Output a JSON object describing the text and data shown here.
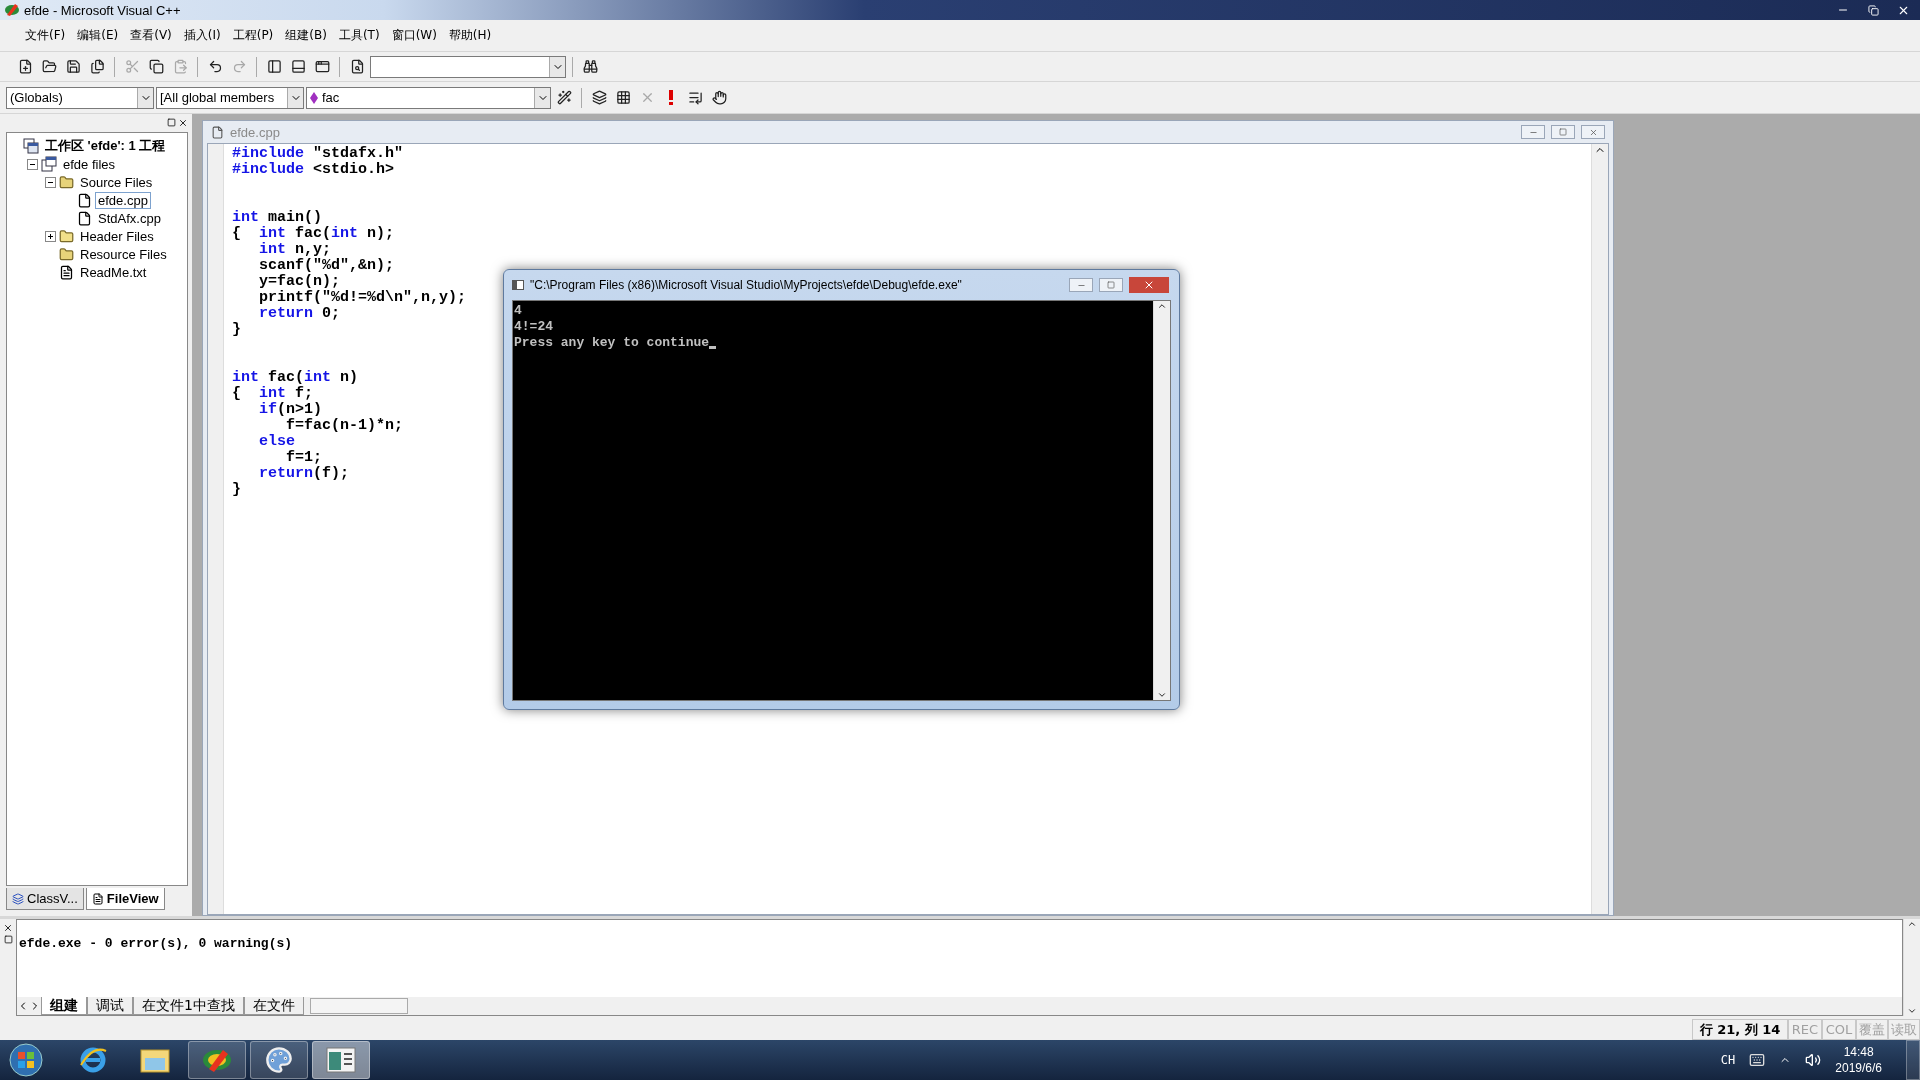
{
  "window": {
    "title": "efde - Microsoft Visual C++"
  },
  "menu": [
    "文件(F)",
    "编辑(E)",
    "查看(V)",
    "插入(I)",
    "工程(P)",
    "组建(B)",
    "工具(T)",
    "窗口(W)",
    "帮助(H)"
  ],
  "toolbar": [
    {
      "kind": "new",
      "disabled": false
    },
    {
      "kind": "open",
      "disabled": false
    },
    {
      "kind": "save",
      "disabled": false
    },
    {
      "kind": "save-all",
      "disabled": false
    },
    {
      "kind": "separator"
    },
    {
      "kind": "cut",
      "disabled": true
    },
    {
      "kind": "copy",
      "disabled": false
    },
    {
      "kind": "paste",
      "disabled": true
    },
    {
      "kind": "separator"
    },
    {
      "kind": "undo",
      "disabled": false
    },
    {
      "kind": "redo",
      "disabled": true
    },
    {
      "kind": "separator"
    },
    {
      "kind": "workspace",
      "disabled": false
    },
    {
      "kind": "output",
      "disabled": false
    },
    {
      "kind": "windows",
      "disabled": false
    },
    {
      "kind": "separator"
    },
    {
      "kind": "find-in-files",
      "disabled": false
    },
    {
      "kind": "find-combo"
    },
    {
      "kind": "separator"
    },
    {
      "kind": "find",
      "disabled": false
    }
  ],
  "wizard_bar": {
    "class_combo": "(Globals)",
    "members_combo": "[All global members",
    "function_combo": "fac"
  },
  "build_toolbar": [
    {
      "kind": "compile",
      "disabled": false
    },
    {
      "kind": "build",
      "disabled": false
    },
    {
      "kind": "stop",
      "disabled": true
    },
    {
      "kind": "execute",
      "disabled": false
    },
    {
      "kind": "step",
      "disabled": false
    },
    {
      "kind": "breakpoint",
      "disabled": false
    }
  ],
  "workspace": {
    "tree": [
      {
        "label": "工作区 'efde': 1 工程",
        "kind": "workspace",
        "children": [
          {
            "label": "efde files",
            "kind": "project",
            "expanded": true,
            "children": [
              {
                "label": "Source Files",
                "kind": "folder",
                "expanded": true,
                "children": [
                  {
                    "label": "efde.cpp",
                    "kind": "cpp",
                    "selected": true
                  },
                  {
                    "label": "StdAfx.cpp",
                    "kind": "cpp",
                    "selected": false
                  }
                ]
              },
              {
                "label": "Header Files",
                "kind": "folder",
                "expanded": false
              },
              {
                "label": "Resource Files",
                "kind": "folder"
              },
              {
                "label": "ReadMe.txt",
                "kind": "text"
              }
            ]
          }
        ]
      }
    ],
    "tabs": [
      {
        "label": "ClassV...",
        "kind": "class",
        "selected": false
      },
      {
        "label": "FileView",
        "kind": "file",
        "selected": true
      }
    ]
  },
  "editor": {
    "title": "efde.cpp",
    "lines": [
      {
        "kind": "code",
        "tokens": [
          {
            "kind": "keyword",
            "text": "#include"
          },
          {
            "kind": "plain",
            "text": " \"stdafx.h\""
          }
        ]
      },
      {
        "kind": "code",
        "tokens": [
          {
            "kind": "keyword",
            "text": "#include"
          },
          {
            "kind": "plain",
            "text": " <stdio.h>"
          }
        ]
      },
      {
        "kind": "blank"
      },
      {
        "kind": "blank"
      },
      {
        "kind": "code",
        "tokens": [
          {
            "kind": "keyword",
            "text": "int"
          },
          {
            "kind": "plain",
            "text": " main()"
          }
        ]
      },
      {
        "kind": "code",
        "tokens": [
          {
            "kind": "plain",
            "text": "{  "
          },
          {
            "kind": "keyword",
            "text": "int"
          },
          {
            "kind": "plain",
            "text": " fac("
          },
          {
            "kind": "keyword",
            "text": "int"
          },
          {
            "kind": "plain",
            "text": " n);"
          }
        ]
      },
      {
        "kind": "code",
        "tokens": [
          {
            "kind": "keyword",
            "text": "   int"
          },
          {
            "kind": "plain",
            "text": " n,y;"
          }
        ]
      },
      {
        "kind": "code",
        "tokens": [
          {
            "kind": "plain",
            "text": "   scanf(\"%d\",&n);"
          }
        ]
      },
      {
        "kind": "code",
        "tokens": [
          {
            "kind": "plain",
            "text": "   y=fac(n);"
          }
        ]
      },
      {
        "kind": "code",
        "tokens": [
          {
            "kind": "plain",
            "text": "   printf(\"%d!=%d\\n\",n,y);"
          }
        ]
      },
      {
        "kind": "code",
        "tokens": [
          {
            "kind": "keyword",
            "text": "   return"
          },
          {
            "kind": "plain",
            "text": " 0;"
          }
        ]
      },
      {
        "kind": "code",
        "tokens": [
          {
            "kind": "plain",
            "text": "}"
          }
        ]
      },
      {
        "kind": "blank"
      },
      {
        "kind": "blank"
      },
      {
        "kind": "code",
        "tokens": [
          {
            "kind": "keyword",
            "text": "int"
          },
          {
            "kind": "plain",
            "text": " fac("
          },
          {
            "kind": "keyword",
            "text": "int"
          },
          {
            "kind": "plain",
            "text": " n)"
          }
        ]
      },
      {
        "kind": "code",
        "tokens": [
          {
            "kind": "plain",
            "text": "{  "
          },
          {
            "kind": "keyword",
            "text": "int"
          },
          {
            "kind": "plain",
            "text": " f;"
          }
        ]
      },
      {
        "kind": "code",
        "tokens": [
          {
            "kind": "keyword",
            "text": "   if"
          },
          {
            "kind": "plain",
            "text": "(n>1)"
          }
        ]
      },
      {
        "kind": "code",
        "tokens": [
          {
            "kind": "plain",
            "text": "      f=fac(n-1)*n;"
          }
        ]
      },
      {
        "kind": "code",
        "tokens": [
          {
            "kind": "keyword",
            "text": "   else"
          }
        ]
      },
      {
        "kind": "code",
        "tokens": [
          {
            "kind": "plain",
            "text": "      f=1;"
          }
        ]
      },
      {
        "kind": "code",
        "tokens": [
          {
            "kind": "keyword",
            "text": "   return"
          },
          {
            "kind": "plain",
            "text": "(f);"
          }
        ]
      },
      {
        "kind": "code",
        "tokens": [
          {
            "kind": "plain",
            "text": "}"
          }
        ]
      }
    ]
  },
  "console": {
    "title": "\"C:\\Program Files (x86)\\Microsoft Visual Studio\\MyProjects\\efde\\Debug\\efde.exe\"",
    "lines": [
      "4",
      "4!=24",
      "Press any key to continue"
    ],
    "cursor": true
  },
  "output": {
    "text": "efde.exe - 0 error(s), 0 warning(s)",
    "tabs": [
      {
        "label": "组建",
        "selected": true
      },
      {
        "label": "调试",
        "selected": false
      },
      {
        "label": "在文件1中查找",
        "selected": false
      },
      {
        "label": "在文件",
        "selected": false
      }
    ]
  },
  "status_bar": [
    {
      "label": "行 21, 列 14",
      "active": true
    },
    {
      "label": "REC",
      "active": false
    },
    {
      "label": "COL",
      "active": false
    },
    {
      "label": "覆盖",
      "active": false
    },
    {
      "label": "读取",
      "active": false
    }
  ],
  "taskbar": {
    "apps": [
      {
        "kind": "browser",
        "running": false,
        "selected": false
      },
      {
        "kind": "explorer",
        "running": false,
        "selected": false
      },
      {
        "kind": "vc",
        "running": true,
        "selected": false
      },
      {
        "kind": "paint",
        "running": true,
        "selected": false
      },
      {
        "kind": "console",
        "running": true,
        "selected": true
      }
    ],
    "tray": {
      "language": "CH",
      "time": "14:48",
      "date": "2019/6/6"
    }
  }
}
